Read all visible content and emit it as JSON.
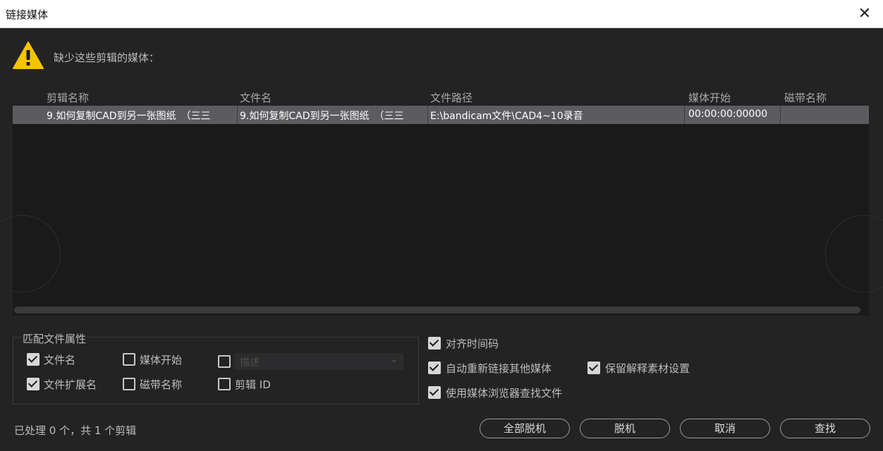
{
  "window": {
    "title": "链接媒体",
    "close_glyph": "✕"
  },
  "header": {
    "message": "缺少这些剪辑的媒体："
  },
  "table": {
    "columns": [
      "剪辑名称",
      "文件名",
      "文件路径",
      "媒体开始",
      "磁带名称"
    ],
    "rows": [
      {
        "clip_name": "9.如何复制CAD到另一张图纸　（三三",
        "file_name": "9.如何复制CAD到另一张图纸　（三三",
        "file_path": "E:\\bandicam文件\\CAD4~10录音",
        "media_start": "00:00:00:00000",
        "tape_name": ""
      }
    ]
  },
  "match_properties": {
    "legend": "匹配文件属性",
    "items": [
      {
        "label": "文件名",
        "checked": true
      },
      {
        "label": "媒体开始",
        "checked": false
      },
      {
        "label": "文件扩展名",
        "checked": true
      },
      {
        "label": "磁带名称",
        "checked": false
      },
      {
        "label": "剪辑 ID",
        "checked": false
      }
    ],
    "description": {
      "checked": false,
      "placeholder": "描述",
      "chevron": "⌄"
    }
  },
  "options": [
    {
      "label": "对齐时间码",
      "checked": true
    },
    {
      "label": "自动重新链接其他媒体",
      "checked": true
    },
    {
      "label": "保留解释素材设置",
      "checked": true
    },
    {
      "label": "使用媒体浏览器查找文件",
      "checked": true
    }
  ],
  "status": {
    "text": "已处理 0 个，共 1 个剪辑"
  },
  "buttons": {
    "offline_all": "全部脱机",
    "offline": "脱机",
    "cancel": "取消",
    "find": "查找"
  },
  "colors": {
    "warning": "#f5c400",
    "row_selected": "#5c5c60",
    "background": "#232323"
  }
}
